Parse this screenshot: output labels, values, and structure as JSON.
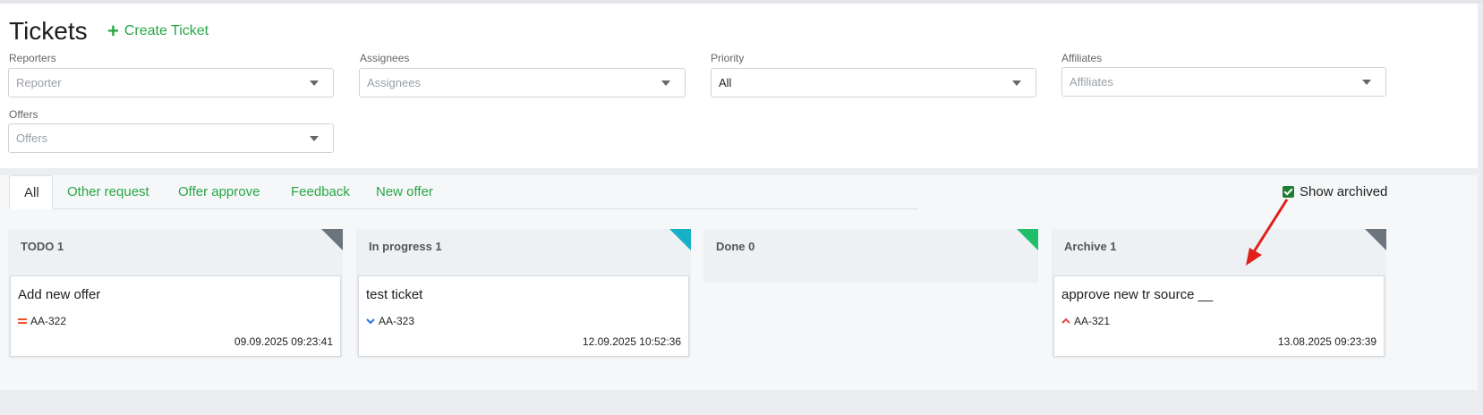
{
  "page": {
    "title": "Tickets",
    "create_label": "Create Ticket"
  },
  "filters": {
    "reporters": {
      "label": "Reporters",
      "placeholder": "Reporter"
    },
    "assignees": {
      "label": "Assignees",
      "placeholder": "Assignees"
    },
    "priority": {
      "label": "Priority",
      "value": "All"
    },
    "affiliates": {
      "label": "Affiliates",
      "placeholder": "Affiliates"
    },
    "offers": {
      "label": "Offers",
      "placeholder": "Offers"
    }
  },
  "tabs": [
    {
      "label": "All"
    },
    {
      "label": "Other request"
    },
    {
      "label": "Offer approve"
    },
    {
      "label": "Feedback"
    },
    {
      "label": "New offer"
    }
  ],
  "show_archived": {
    "label": "Show archived",
    "checked": true
  },
  "columns": [
    {
      "title": "TODO 1",
      "corner_color": "#6c757d",
      "card": {
        "title": "Add new offer",
        "key": "AA-322",
        "date": "09.09.2025 09:23:41",
        "priority_icon": "equals-icon",
        "priority_color": "#e8542f"
      }
    },
    {
      "title": "In progress 1",
      "corner_color": "#17b0c9",
      "card": {
        "title": "test ticket",
        "key": "AA-323",
        "date": "12.09.2025 10:52:36",
        "priority_icon": "chevron-down-icon",
        "priority_color": "#2f6fe8"
      }
    },
    {
      "title": "Done 0",
      "corner_color": "#1fbf6a"
    },
    {
      "title": "Archive 1",
      "corner_color": "#6c757d",
      "card": {
        "title": "approve new tr source __",
        "key": "AA-321",
        "date": "13.08.2025 09:23:39",
        "priority_icon": "chevron-up-icon",
        "priority_color": "#e84545"
      }
    }
  ],
  "colors": {
    "accent": "#28a745",
    "annotation_arrow": "#e0201c"
  }
}
